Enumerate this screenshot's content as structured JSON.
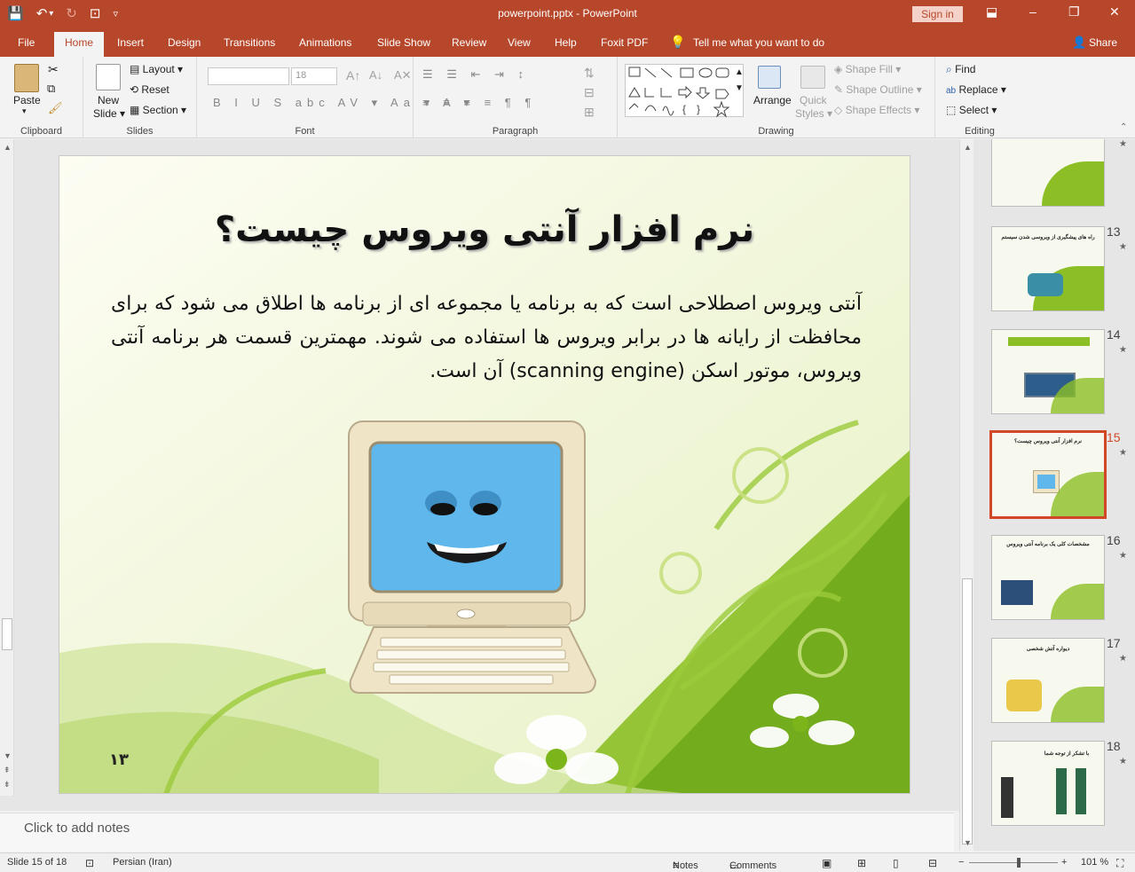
{
  "window": {
    "title": "powerpoint.pptx - PowerPoint",
    "signin": "Sign in",
    "minimize": "–",
    "restore": "❐",
    "close": "✕",
    "ribbon_display": "⬓"
  },
  "qat": {
    "save": "💾",
    "undo": "↶",
    "undo_dd": "▾",
    "redo": "↻",
    "present": "⊡",
    "customize": "▿"
  },
  "tabs": [
    "File",
    "Home",
    "Insert",
    "Design",
    "Transitions",
    "Animations",
    "Slide Show",
    "Review",
    "View",
    "Help",
    "Foxit PDF"
  ],
  "active_tab": "Home",
  "tellme": "Tell me what you want to do",
  "share": "Share",
  "ribbon": {
    "clipboard": {
      "label": "Clipboard",
      "paste": "Paste",
      "paste_dd": "▾"
    },
    "slides": {
      "label": "Slides",
      "new_slide": "New",
      "new_slide2": "Slide ▾",
      "layout": "Layout ▾",
      "reset": "Reset",
      "section": "Section ▾"
    },
    "font": {
      "label": "Font",
      "font_name": "",
      "font_size": "18",
      "format_row": "B I U S abc AV ▾ Aa ▾ A ▾"
    },
    "paragraph": {
      "label": "Paragraph",
      "row1": "☰ ☰ ⇤ ⇥ ↕",
      "row2": "≡ ≡ ≡ ≡ ¶ ¶"
    },
    "drawing": {
      "label": "Drawing",
      "arrange": "Arrange",
      "quick_styles": "Quick",
      "quick_styles2": "Styles ▾",
      "shape_fill": "Shape Fill ▾",
      "shape_outline": "Shape Outline ▾",
      "shape_effects": "Shape Effects ▾"
    },
    "editing": {
      "label": "Editing",
      "find": "Find",
      "replace": "Replace ▾",
      "select": "Select ▾"
    }
  },
  "slide": {
    "title": "نرم افزار آنتی ویروس چیست؟",
    "body": "آنتی ویروس اصطلاحی است که به برنامه یا مجموعه ای از برنامه ها اطلاق می شود که برای محافظت از رایانه ها در برابر ویروس ها استفاده می شوند. مهمترین قسمت هر برنامه آنتی ویروس،  موتور اسکن (scanning engine) آن است.",
    "number": "۱۳"
  },
  "notes_placeholder": "Click to add notes",
  "thumbnails": [
    {
      "num": "",
      "title": ""
    },
    {
      "num": "13",
      "title": "راه های پیشگیری از ویروسی شدن سیستم"
    },
    {
      "num": "14",
      "title": ""
    },
    {
      "num": "15",
      "title": "نرم افزار آنتی ویروس چیست؟"
    },
    {
      "num": "16",
      "title": "مشخصات کلی یک برنامه آنتی ویروس"
    },
    {
      "num": "17",
      "title": "دیواره آتش شخصی"
    },
    {
      "num": "18",
      "title": "با تشکر از توجه شما"
    }
  ],
  "star": "★",
  "status": {
    "slide_info": "Slide 15 of 18",
    "language": "Persian (Iran)",
    "notes": "Notes",
    "comments": "Comments",
    "zoom": "101 %",
    "zoom_minus": "−",
    "zoom_plus": "+",
    "zoom_level": 0.56
  },
  "colors": {
    "accent": "#b7472a",
    "selected": "#d24726",
    "leaf": "#8cbf26"
  }
}
